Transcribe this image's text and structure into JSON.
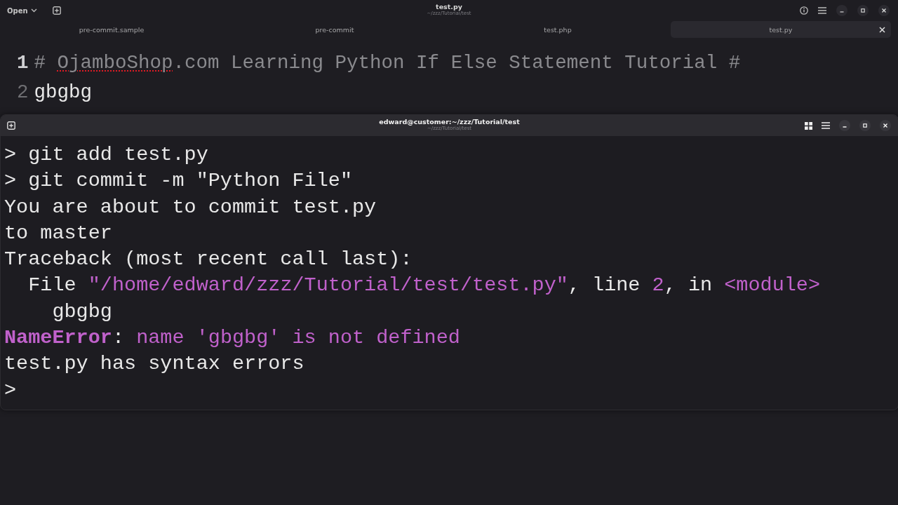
{
  "editor": {
    "header": {
      "open_button": "Open",
      "title": "test.py",
      "subtitle": "~/zzz/Tutorial/test"
    },
    "tabs": [
      {
        "label": "pre-commit.sample",
        "selected": false
      },
      {
        "label": "pre-commit",
        "selected": false
      },
      {
        "label": "test.php",
        "selected": false
      },
      {
        "label": "test.py",
        "selected": true
      }
    ],
    "lines": [
      {
        "number": "1",
        "current": true,
        "kind": "comment",
        "segments": [
          {
            "text": "# ",
            "misspelled": false
          },
          {
            "text": "OjamboShop",
            "misspelled": true
          },
          {
            "text": ".com Learning Python If Else Statement Tutorial #",
            "misspelled": false
          }
        ]
      },
      {
        "number": "2",
        "current": false,
        "kind": "code",
        "segments": [
          {
            "text": "gbgbg",
            "misspelled": false
          }
        ]
      }
    ]
  },
  "terminal": {
    "title": "edward@customer:~/zzz/Tutorial/test",
    "subtitle": "~/zzz/Tutorial/test",
    "lines": [
      [
        {
          "kind": "plain",
          "text": "> git add test.py"
        }
      ],
      [
        {
          "kind": "plain",
          "text": "> git commit -m \"Python File\""
        }
      ],
      [
        {
          "kind": "plain",
          "text": "You are about to commit test.py"
        }
      ],
      [
        {
          "kind": "plain",
          "text": "to master"
        }
      ],
      [
        {
          "kind": "plain",
          "text": "Traceback (most recent call last):"
        }
      ],
      [
        {
          "kind": "plain",
          "text": "  File "
        },
        {
          "kind": "string",
          "text": "\"/home/edward/zzz/Tutorial/test/test.py\""
        },
        {
          "kind": "plain",
          "text": ", line "
        },
        {
          "kind": "number",
          "text": "2"
        },
        {
          "kind": "plain",
          "text": ", in "
        },
        {
          "kind": "name",
          "text": "<module>"
        }
      ],
      [
        {
          "kind": "plain",
          "text": "    gbgbg"
        }
      ],
      [
        {
          "kind": "error",
          "text": "NameError"
        },
        {
          "kind": "plain",
          "text": ": "
        },
        {
          "kind": "message",
          "text": "name 'gbgbg' is not defined"
        }
      ],
      [
        {
          "kind": "plain",
          "text": "test.py has syntax errors"
        }
      ],
      [
        {
          "kind": "plain",
          "text": ">"
        }
      ]
    ]
  }
}
